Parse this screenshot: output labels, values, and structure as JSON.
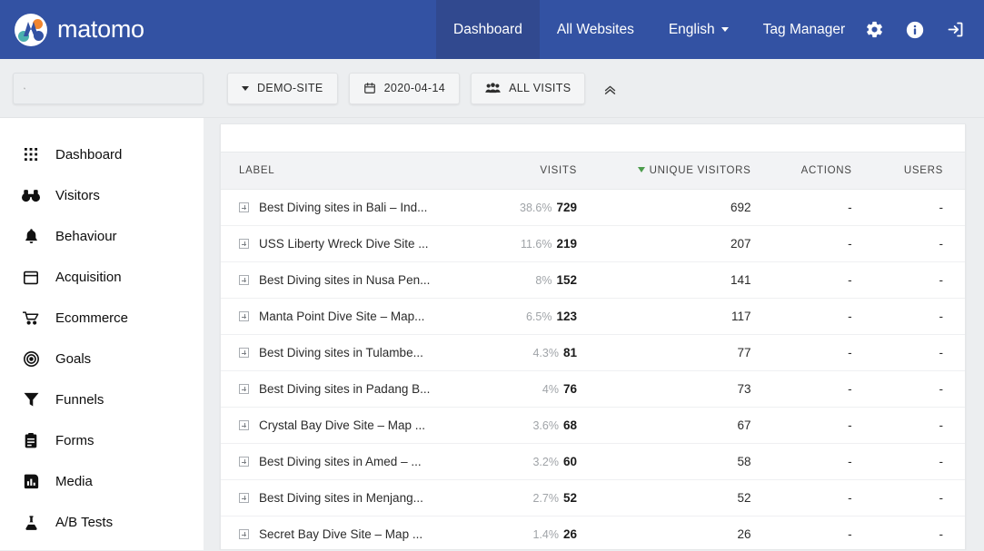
{
  "brand": {
    "name": "matomo",
    "logo_icon": "matomo-logo-icon"
  },
  "topnav": {
    "items": [
      {
        "label": "Dashboard",
        "active": true
      },
      {
        "label": "All Websites",
        "active": false
      },
      {
        "label": "English",
        "active": false,
        "caret": true
      },
      {
        "label": "Tag Manager",
        "active": false
      }
    ],
    "icons": [
      {
        "name": "gear-icon"
      },
      {
        "name": "info-icon"
      },
      {
        "name": "sign-in-icon"
      }
    ]
  },
  "toolbar": {
    "search": {
      "value": "",
      "placeholder": "",
      "icon": "search-icon"
    },
    "site_selector": {
      "label": "DEMO-SITE",
      "icon": "caret-down-icon"
    },
    "date_selector": {
      "label": "2020-04-14",
      "icon": "calendar-icon"
    },
    "segment_selector": {
      "label": "ALL VISITS",
      "icon": "visitors-group-icon"
    },
    "collapse": {
      "icon": "chevron-double-up-icon"
    }
  },
  "sidebar": {
    "items": [
      {
        "label": "Dashboard",
        "icon": "grid-icon"
      },
      {
        "label": "Visitors",
        "icon": "binoculars-icon"
      },
      {
        "label": "Behaviour",
        "icon": "bell-icon"
      },
      {
        "label": "Acquisition",
        "icon": "browser-window-icon"
      },
      {
        "label": "Ecommerce",
        "icon": "shopping-cart-icon"
      },
      {
        "label": "Goals",
        "icon": "target-icon"
      },
      {
        "label": "Funnels",
        "icon": "funnel-icon"
      },
      {
        "label": "Forms",
        "icon": "clipboard-icon"
      },
      {
        "label": "Media",
        "icon": "media-play-icon"
      },
      {
        "label": "A/B Tests",
        "icon": "flask-icon"
      }
    ]
  },
  "table": {
    "columns": [
      {
        "key": "label",
        "label": "Label",
        "sorted": false
      },
      {
        "key": "visits",
        "label": "Visits",
        "sorted": false
      },
      {
        "key": "unique_visitors",
        "label": "Unique Visitors",
        "sorted": true,
        "sort_dir": "desc"
      },
      {
        "key": "actions",
        "label": "Actions",
        "sorted": false
      },
      {
        "key": "users",
        "label": "Users",
        "sorted": false
      }
    ],
    "sort_indicator_color": "#4c9c4c",
    "rows": [
      {
        "label": "Best Diving sites in Bali – Ind...",
        "pct": "38.6%",
        "visits": "729",
        "unique_visitors": "692",
        "actions": "-",
        "users": "-"
      },
      {
        "label": "USS Liberty Wreck Dive Site ...",
        "pct": "11.6%",
        "visits": "219",
        "unique_visitors": "207",
        "actions": "-",
        "users": "-"
      },
      {
        "label": "Best Diving sites in Nusa Pen...",
        "pct": "8%",
        "visits": "152",
        "unique_visitors": "141",
        "actions": "-",
        "users": "-"
      },
      {
        "label": "Manta Point Dive Site – Map...",
        "pct": "6.5%",
        "visits": "123",
        "unique_visitors": "117",
        "actions": "-",
        "users": "-"
      },
      {
        "label": "Best Diving sites in Tulambe...",
        "pct": "4.3%",
        "visits": "81",
        "unique_visitors": "77",
        "actions": "-",
        "users": "-"
      },
      {
        "label": "Best Diving sites in Padang B...",
        "pct": "4%",
        "visits": "76",
        "unique_visitors": "73",
        "actions": "-",
        "users": "-"
      },
      {
        "label": "Crystal Bay Dive Site – Map ...",
        "pct": "3.6%",
        "visits": "68",
        "unique_visitors": "67",
        "actions": "-",
        "users": "-"
      },
      {
        "label": "Best Diving sites in Amed – ...",
        "pct": "3.2%",
        "visits": "60",
        "unique_visitors": "58",
        "actions": "-",
        "users": "-"
      },
      {
        "label": "Best Diving sites in Menjang...",
        "pct": "2.7%",
        "visits": "52",
        "unique_visitors": "52",
        "actions": "-",
        "users": "-"
      },
      {
        "label": "Secret Bay Dive Site – Map ...",
        "pct": "1.4%",
        "visits": "26",
        "unique_visitors": "26",
        "actions": "-",
        "users": "-"
      }
    ]
  },
  "colors": {
    "header_blue": "#3352a3",
    "header_blue_active": "#31498f",
    "page_bg": "#eceef0",
    "sort_green": "#4c9c4c",
    "logo_teal": "#4bb0ae",
    "logo_orange": "#f1862f"
  }
}
